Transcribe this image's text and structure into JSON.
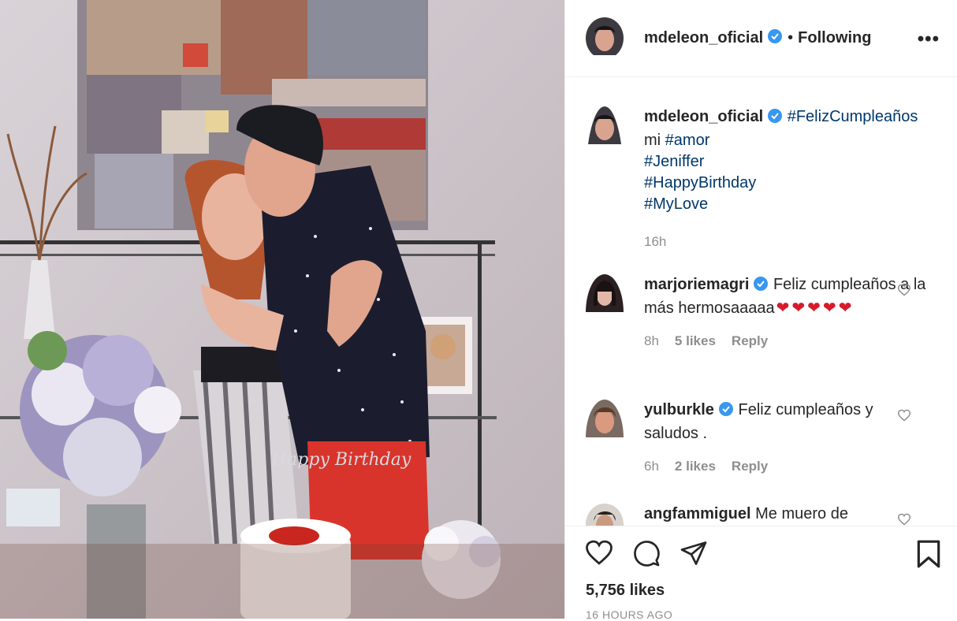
{
  "post": {
    "author": "mdeleon_oficial",
    "follow_state": "Following",
    "dot": "•",
    "more_glyph": "•••",
    "caption_author": "mdeleon_oficial",
    "caption_tag1": "#FelizCumpleaños",
    "caption_word": "mi",
    "caption_tag2": "#amor",
    "caption_tag3": "#Jeniffer",
    "caption_tag4": "#HappyBirthday",
    "caption_tag5": "#MyLove",
    "caption_time": "16h",
    "likes": "5,756 likes",
    "posted_ago": "16 HOURS AGO",
    "cake_topper": "Happy Birthday"
  },
  "comments": [
    {
      "user": "marjoriemagri",
      "verified": true,
      "text": "Feliz cumpleaños a la más hermosaaaaa",
      "emoji": "❤❤❤❤❤",
      "time": "8h",
      "likes": "5 likes",
      "reply": "Reply"
    },
    {
      "user": "yulburkle",
      "verified": true,
      "text": "Feliz cumpleaños y saludos .",
      "time": "6h",
      "likes": "2 likes",
      "reply": "Reply"
    },
    {
      "user": "angfammiguel",
      "verified": false,
      "text": "Me muero de"
    }
  ],
  "colors": {
    "link": "#00376b",
    "verified": "#3897f0",
    "muted": "#8e8e8e",
    "text": "#262626"
  },
  "icons": [
    "heart-icon",
    "comment-icon",
    "share-icon",
    "bookmark-icon",
    "more-options-icon",
    "verified-badge-icon"
  ]
}
